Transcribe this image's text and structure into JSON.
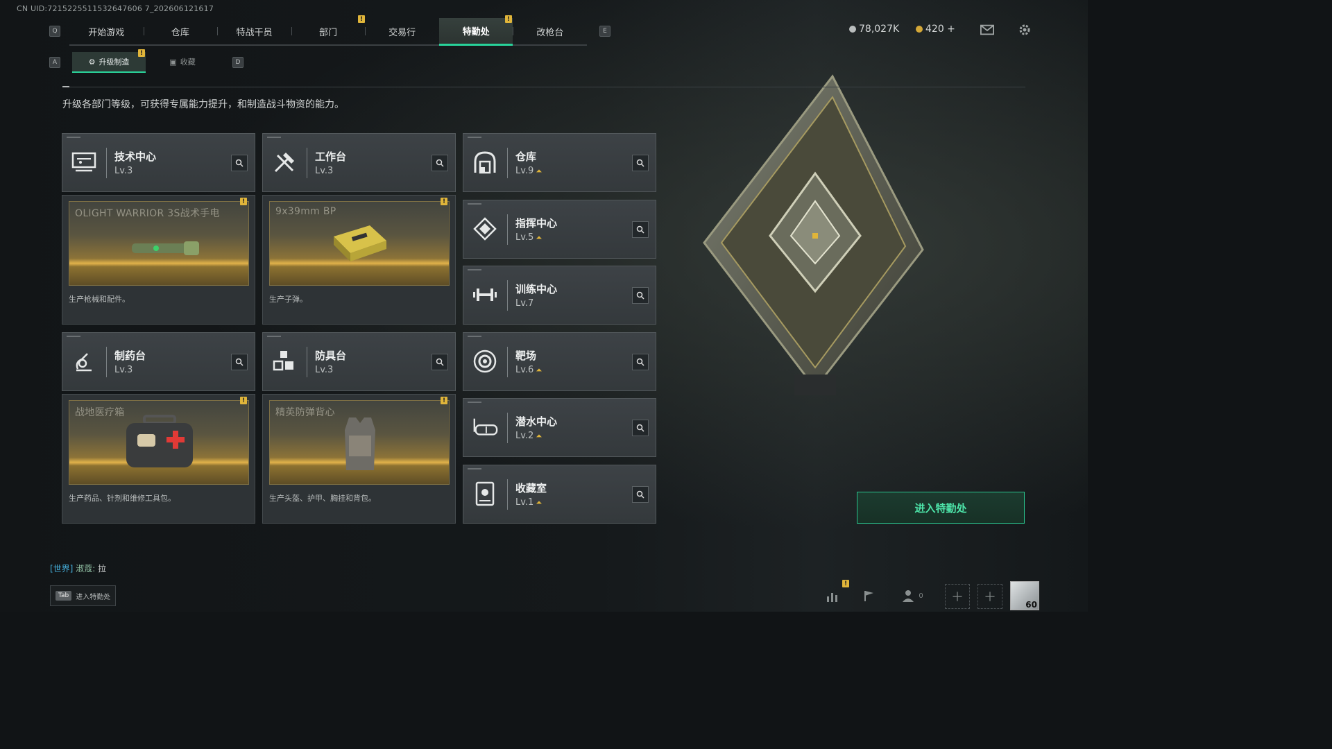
{
  "uid": "CN UID:7215225511532647606 7_202606121617",
  "nav": {
    "left_key": "Q",
    "right_key": "E",
    "tabs": [
      {
        "label": "开始游戏"
      },
      {
        "label": "仓库"
      },
      {
        "label": "特战干员"
      },
      {
        "label": "部门"
      },
      {
        "label": "交易行"
      },
      {
        "label": "特勤处"
      },
      {
        "label": "改枪台"
      }
    ],
    "active_tab": "特勤处"
  },
  "currency": {
    "silver": "78,027K",
    "gold": "420 +"
  },
  "subtabs": {
    "left_key": "A",
    "right_key": "D",
    "items": [
      {
        "label": "升级制造"
      },
      {
        "label": "收藏"
      }
    ]
  },
  "description": "升级各部门等级，可获得专属能力提升，和制造战斗物资的能力。",
  "facilities": {
    "tech": {
      "name": "技术中心",
      "level": "Lv.3"
    },
    "workbench": {
      "name": "工作台",
      "level": "Lv.3"
    },
    "storage": {
      "name": "仓库",
      "level": "Lv.9"
    },
    "command": {
      "name": "指挥中心",
      "level": "Lv.5"
    },
    "training": {
      "name": "训练中心",
      "level": "Lv.7"
    },
    "pharmacy": {
      "name": "制药台",
      "level": "Lv.3"
    },
    "armor": {
      "name": "防具台",
      "level": "Lv.3"
    },
    "range": {
      "name": "靶场",
      "level": "Lv.6"
    },
    "diving": {
      "name": "潜水中心",
      "level": "Lv.2"
    },
    "collection": {
      "name": "收藏室",
      "level": "Lv.1"
    }
  },
  "productions": {
    "tech": {
      "title": "OLIGHT WARRIOR 3S战术手电",
      "desc": "生产枪械和配件。"
    },
    "workbench": {
      "title": "9x39mm BP",
      "desc": "生产子弹。"
    },
    "pharmacy": {
      "title": "战地医疗箱",
      "desc": "生产药品、针剂和维修工具包。"
    },
    "armor": {
      "title": "精英防弹背心",
      "desc": "生产头盔、护甲、胸挂和背包。"
    }
  },
  "badge_symbol": "!",
  "enter_button": "进入特勤处",
  "chat": {
    "channel": "[世界]",
    "user": "淑蔻:",
    "message": "拉"
  },
  "tab_hint": {
    "key": "Tab",
    "label": "进入特勤处"
  },
  "bottom": {
    "friends_count": "0",
    "player_level": "60"
  },
  "colors": {
    "accent": "#28d39a",
    "badge": "#e0b53a"
  }
}
